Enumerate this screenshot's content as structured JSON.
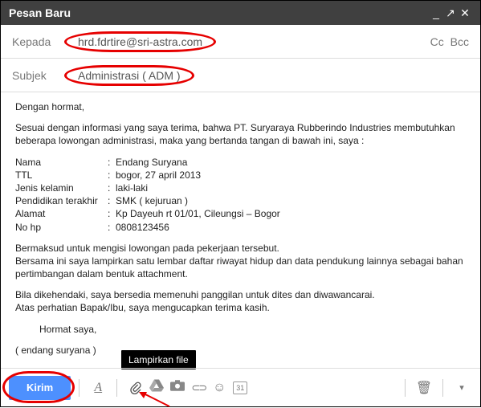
{
  "titlebar": {
    "title": "Pesan Baru"
  },
  "recipients": {
    "label": "Kepada",
    "to_value": "hrd.fdrtire@sri-astra.com",
    "cc_label": "Cc",
    "bcc_label": "Bcc"
  },
  "subject": {
    "label": "Subjek",
    "value": "Administrasi ( ADM )"
  },
  "body": {
    "greeting": "Dengan hormat,",
    "intro": "Sesuai dengan informasi yang saya terima, bahwa PT. Suryaraya Rubberindo Industries membutuhkan beberapa lowongan administrasi, maka yang bertanda tangan di bawah ini, saya :",
    "bio": [
      {
        "k": "Nama",
        "v": "Endang Suryana"
      },
      {
        "k": "TTL",
        "v": "bogor, 27 april 2013"
      },
      {
        "k": "Jenis kelamin",
        "v": "laki-laki"
      },
      {
        "k": "Pendidikan terakhir",
        "v": "SMK ( kejuruan )"
      },
      {
        "k": "Alamat",
        "v": "Kp Dayeuh rt 01/01, Cileungsi – Bogor"
      },
      {
        "k": "No hp",
        "v": "0808123456"
      }
    ],
    "para1": "Bermaksud untuk mengisi lowongan pada pekerjaan tersebut.",
    "para2": "Bersama ini saya lampirkan satu lembar daftar riwayat hidup dan data pendukung lainnya sebagai bahan pertimbangan dalam bentuk attachment.",
    "para3": "Bila dikehendaki, saya bersedia memenuhi panggilan untuk dites dan diwawancarai.",
    "para4": "Atas perhatian Bapak/Ibu, saya mengucapkan terima kasih.",
    "closing": "Hormat saya,",
    "signature": "( endang suryana )"
  },
  "tooltip": {
    "attach": "Lampirkan file"
  },
  "toolbar": {
    "send_label": "Kirim",
    "format_glyph": "A",
    "link_glyph": "⊂⊃",
    "emoji_glyph": "☺",
    "calendar_glyph": "31",
    "trash_glyph": "🗑",
    "more_glyph": "▾"
  }
}
